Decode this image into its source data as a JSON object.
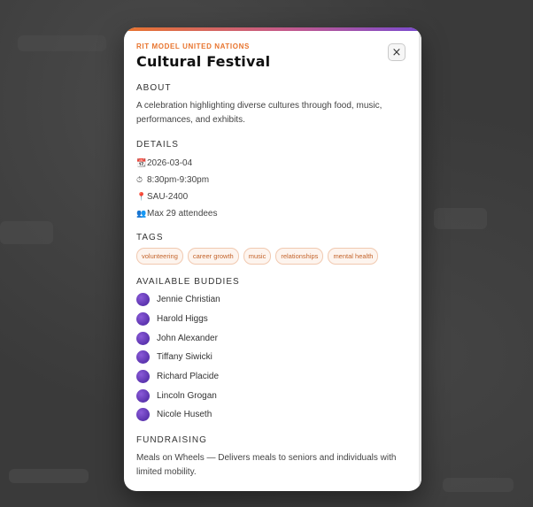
{
  "event": {
    "org": "RIT MODEL UNITED NATIONS",
    "title": "Cultural Festival",
    "close_label": "×"
  },
  "about": {
    "heading": "ABOUT",
    "text": "A celebration highlighting diverse cultures through food, music, performances, and exhibits."
  },
  "details": {
    "heading": "DETAILS",
    "date_icon": "📆",
    "date": "2026-03-04",
    "time_icon": "⏱",
    "time": "8:30pm-9:30pm",
    "location_icon": "📍",
    "location": "SAU-2400",
    "capacity_icon": "👥",
    "capacity": "Max 29 attendees"
  },
  "tags": {
    "heading": "TAGS",
    "items": [
      "volunteering",
      "career growth",
      "music",
      "relationships",
      "mental health"
    ]
  },
  "buddies": {
    "heading": "AVAILABLE BUDDIES",
    "items": [
      "Jennie Christian",
      "Harold Higgs",
      "John Alexander",
      "Tiffany Siwicki",
      "Richard Placide",
      "Lincoln Grogan",
      "Nicole Huseth"
    ]
  },
  "fundraising": {
    "heading": "FUNDRAISING",
    "text": "Meals on Wheels — Delivers meals to seniors and individuals with limited mobility."
  },
  "colors": {
    "accent": "#e8742e",
    "avatar": "#6a40c0"
  }
}
